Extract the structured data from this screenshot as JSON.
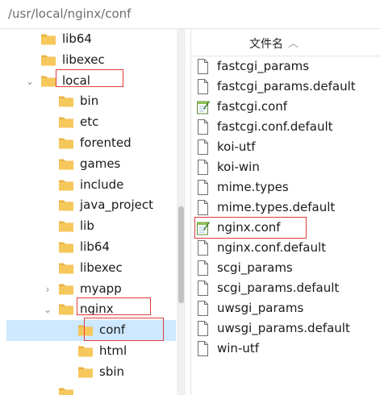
{
  "address_bar": {
    "path": "/usr/local/nginx/conf"
  },
  "tree": {
    "items": [
      {
        "label": "lib64"
      },
      {
        "label": "libexec"
      },
      {
        "label": "local"
      },
      {
        "label": "bin"
      },
      {
        "label": "etc"
      },
      {
        "label": "forented"
      },
      {
        "label": "games"
      },
      {
        "label": "include"
      },
      {
        "label": "java_project"
      },
      {
        "label": "lib"
      },
      {
        "label": "lib64"
      },
      {
        "label": "libexec"
      },
      {
        "label": "myapp"
      },
      {
        "label": "nginx"
      },
      {
        "label": "conf"
      },
      {
        "label": "html"
      },
      {
        "label": "sbin"
      },
      {
        "label": "..."
      }
    ]
  },
  "file_list": {
    "column_header": "文件名",
    "sort_icon": "sort-up-chevron",
    "files": [
      {
        "name": "fastcgi_params",
        "icon": "document-icon"
      },
      {
        "name": "fastcgi_params.default",
        "icon": "document-icon"
      },
      {
        "name": "fastcgi.conf",
        "icon": "notepad-edit-icon"
      },
      {
        "name": "fastcgi.conf.default",
        "icon": "document-icon"
      },
      {
        "name": "koi-utf",
        "icon": "document-icon"
      },
      {
        "name": "koi-win",
        "icon": "document-icon"
      },
      {
        "name": "mime.types",
        "icon": "document-icon"
      },
      {
        "name": "mime.types.default",
        "icon": "document-icon"
      },
      {
        "name": "nginx.conf",
        "icon": "notepad-edit-icon"
      },
      {
        "name": "nginx.conf.default",
        "icon": "document-icon"
      },
      {
        "name": "scgi_params",
        "icon": "document-icon"
      },
      {
        "name": "scgi_params.default",
        "icon": "document-icon"
      },
      {
        "name": "uwsgi_params",
        "icon": "document-icon"
      },
      {
        "name": "uwsgi_params.default",
        "icon": "document-icon"
      },
      {
        "name": "win-utf",
        "icon": "document-icon"
      }
    ]
  },
  "colors": {
    "folder": "#F6C75B",
    "selection": "#CDE8FF",
    "highlight_box": "#E03C3C"
  }
}
